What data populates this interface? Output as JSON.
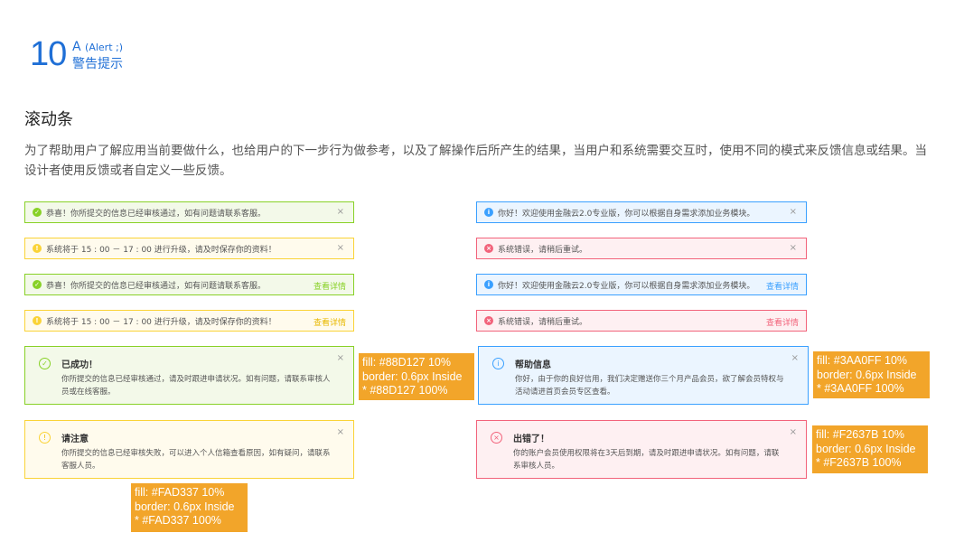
{
  "header": {
    "number": "10",
    "letter": "A",
    "en": "(Alert ;)",
    "cn": "警告提示"
  },
  "section_title": "滚动条",
  "description": "为了帮助用户了解应用当前要做什么，也给用户的下一步行为做参考，以及了解操作后所产生的结果，当用户和系统需要交互时，使用不同的模式来反馈信息或结果。当设计者使用反馈或者自定义一些反馈。",
  "colors": {
    "success": "#88D127",
    "warning": "#FAD337",
    "info": "#3AA0FF",
    "error": "#F2637B",
    "note": "#F2A52A"
  },
  "alerts": [
    {
      "text": "恭喜！你所提交的信息已经审核通过，如有问题请联系客服。",
      "close": "×"
    },
    {
      "text": "系统将于 15 : 00 － 17 : 00 进行升级，请及时保存你的资料！",
      "close": "×"
    },
    {
      "text": "恭喜！你所提交的信息已经审核通过，如有问题请联系客服。",
      "link": "查看详情"
    },
    {
      "text": "系统将于 15 : 00 － 17 : 00 进行升级，请及时保存你的资料！",
      "link": "查看详情"
    },
    {
      "text": "你好！欢迎使用金融云2.0专业版，你可以根据自身需求添加业务模块。",
      "close": "×"
    },
    {
      "text": "系统错误，请稍后重试。",
      "close": "×"
    },
    {
      "text": "你好！欢迎使用金融云2.0专业版，你可以根据自身需求添加业务模块。",
      "link": "查看详情"
    },
    {
      "text": "系统错误，请稍后重试。",
      "link": "查看详情"
    }
  ],
  "big_alerts": [
    {
      "title": "已成功！",
      "body": "你所提交的信息已经审核通过，请及时跟进申请状况。如有问题，请联系审核人员或在线客服。",
      "close": "×"
    },
    {
      "title": "请注意",
      "body": "你所提交的信息已经审核失败，可以进入个人信箱查看原因，如有疑问，请联系客服人员。",
      "close": "×"
    },
    {
      "title": "帮助信息",
      "body": "你好，由于你的良好信用，我们决定赠送你三个月产品会员，欲了解会员特权与活动请进首页会员专区查看。",
      "close": "×"
    },
    {
      "title": "出错了！",
      "body": "你的账户会员使用权限将在3天后到期，请及时跟进申请状况。如有问题，请联系审核人员。",
      "close": "×"
    }
  ],
  "notes": [
    {
      "l1": "fill: #88D127 10%",
      "l2": "border: 0.6px Inside",
      "l3": " * #88D127 100%"
    },
    {
      "l1": "fill: #3AA0FF 10%",
      "l2": "border: 0.6px Inside",
      "l3": " * #3AA0FF 100%"
    },
    {
      "l1": "fill: #F2637B 10%",
      "l2": "border: 0.6px Inside",
      "l3": " * #F2637B 100%"
    },
    {
      "l1": "fill: #FAD337 10%",
      "l2": "border: 0.6px Inside",
      "l3": " * #FAD337 100%"
    }
  ]
}
